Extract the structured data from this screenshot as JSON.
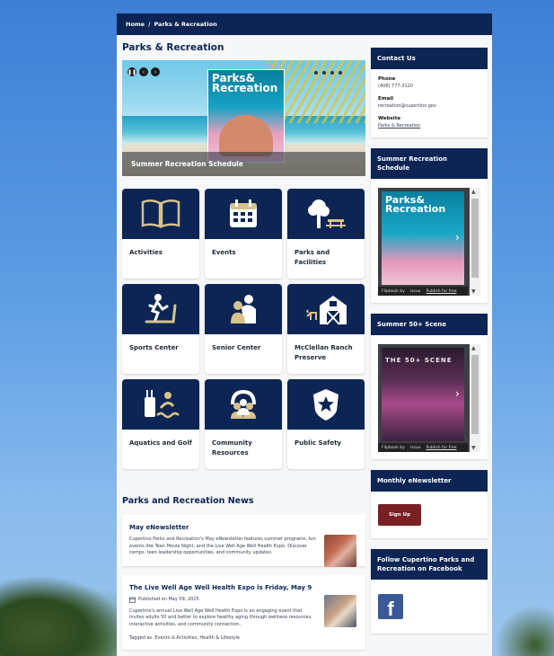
{
  "breadcrumb": {
    "home": "Home",
    "sep": "/",
    "current": "Parks & Recreation"
  },
  "page_title": "Parks & Recreation",
  "hero": {
    "poster_title": "Parks& Recreation",
    "caption": "Summer Recreation Schedule",
    "ctrl_pause": "❚❚",
    "ctrl_prev": "‹",
    "ctrl_next": "›"
  },
  "tiles": [
    {
      "label": "Activities",
      "icon": "book-icon"
    },
    {
      "label": "Events",
      "icon": "calendar-icon"
    },
    {
      "label": "Parks and Facilities",
      "icon": "tree-picnic-icon"
    },
    {
      "label": "Sports Center",
      "icon": "treadmill-icon"
    },
    {
      "label": "Senior Center",
      "icon": "senior-couple-icon"
    },
    {
      "label": "McClellan Ranch Preserve",
      "icon": "barn-icon"
    },
    {
      "label": "Aquatics and Golf",
      "icon": "golf-swim-icon"
    },
    {
      "label": "Community Resources",
      "icon": "community-icon"
    },
    {
      "label": "Public Safety",
      "icon": "badge-icon"
    }
  ],
  "news": {
    "heading": "Parks and Recreation News",
    "items": [
      {
        "title": "May eNewsletter",
        "body": "Cupertino Parks and Recreation's May eNewsletter features summer programs, fun events like Teen Movie Night, and the Live Well Age Well Health Expo. Discover camps, teen leadership opportunities, and community updates."
      },
      {
        "title": "The Live Well Age Well Health Expo is Friday, May 9",
        "published": "Published on May 09, 2025",
        "body": "Cupertino's annual Live Well Age Well Health Expo is an engaging event that invites adults 50 and better to explore healthy aging through wellness resources, interactive activities, and community connection.",
        "tags": "Tagged as: Events & Activities, Health & Lifestyle"
      }
    ]
  },
  "sidebar": {
    "contact": {
      "heading": "Contact Us",
      "phone_label": "Phone",
      "phone": "(408) 777-3120",
      "email_label": "Email",
      "email": "recreation@cupertino.gov",
      "website_label": "Website",
      "website": "Parks & Recreation"
    },
    "summer_schedule": {
      "heading": "Summer Recreation Schedule",
      "cover_title": "Parks& Recreation"
    },
    "summer50": {
      "heading": "Summer 50+ Scene",
      "cover_title": "THE 50+ SCENE"
    },
    "flip_bar": {
      "by": "Flipbook by",
      "brand": "issuu",
      "publish": "Publish for free"
    },
    "newsletter": {
      "heading": "Monthly eNewsletter",
      "button": "Sign Up"
    },
    "facebook": {
      "heading": "Follow Cupertino Parks and Recreation on Facebook",
      "glyph": "f"
    }
  },
  "colors": {
    "navy": "#0c2554",
    "maroon": "#7a1f22",
    "facebook": "#3b5998"
  }
}
